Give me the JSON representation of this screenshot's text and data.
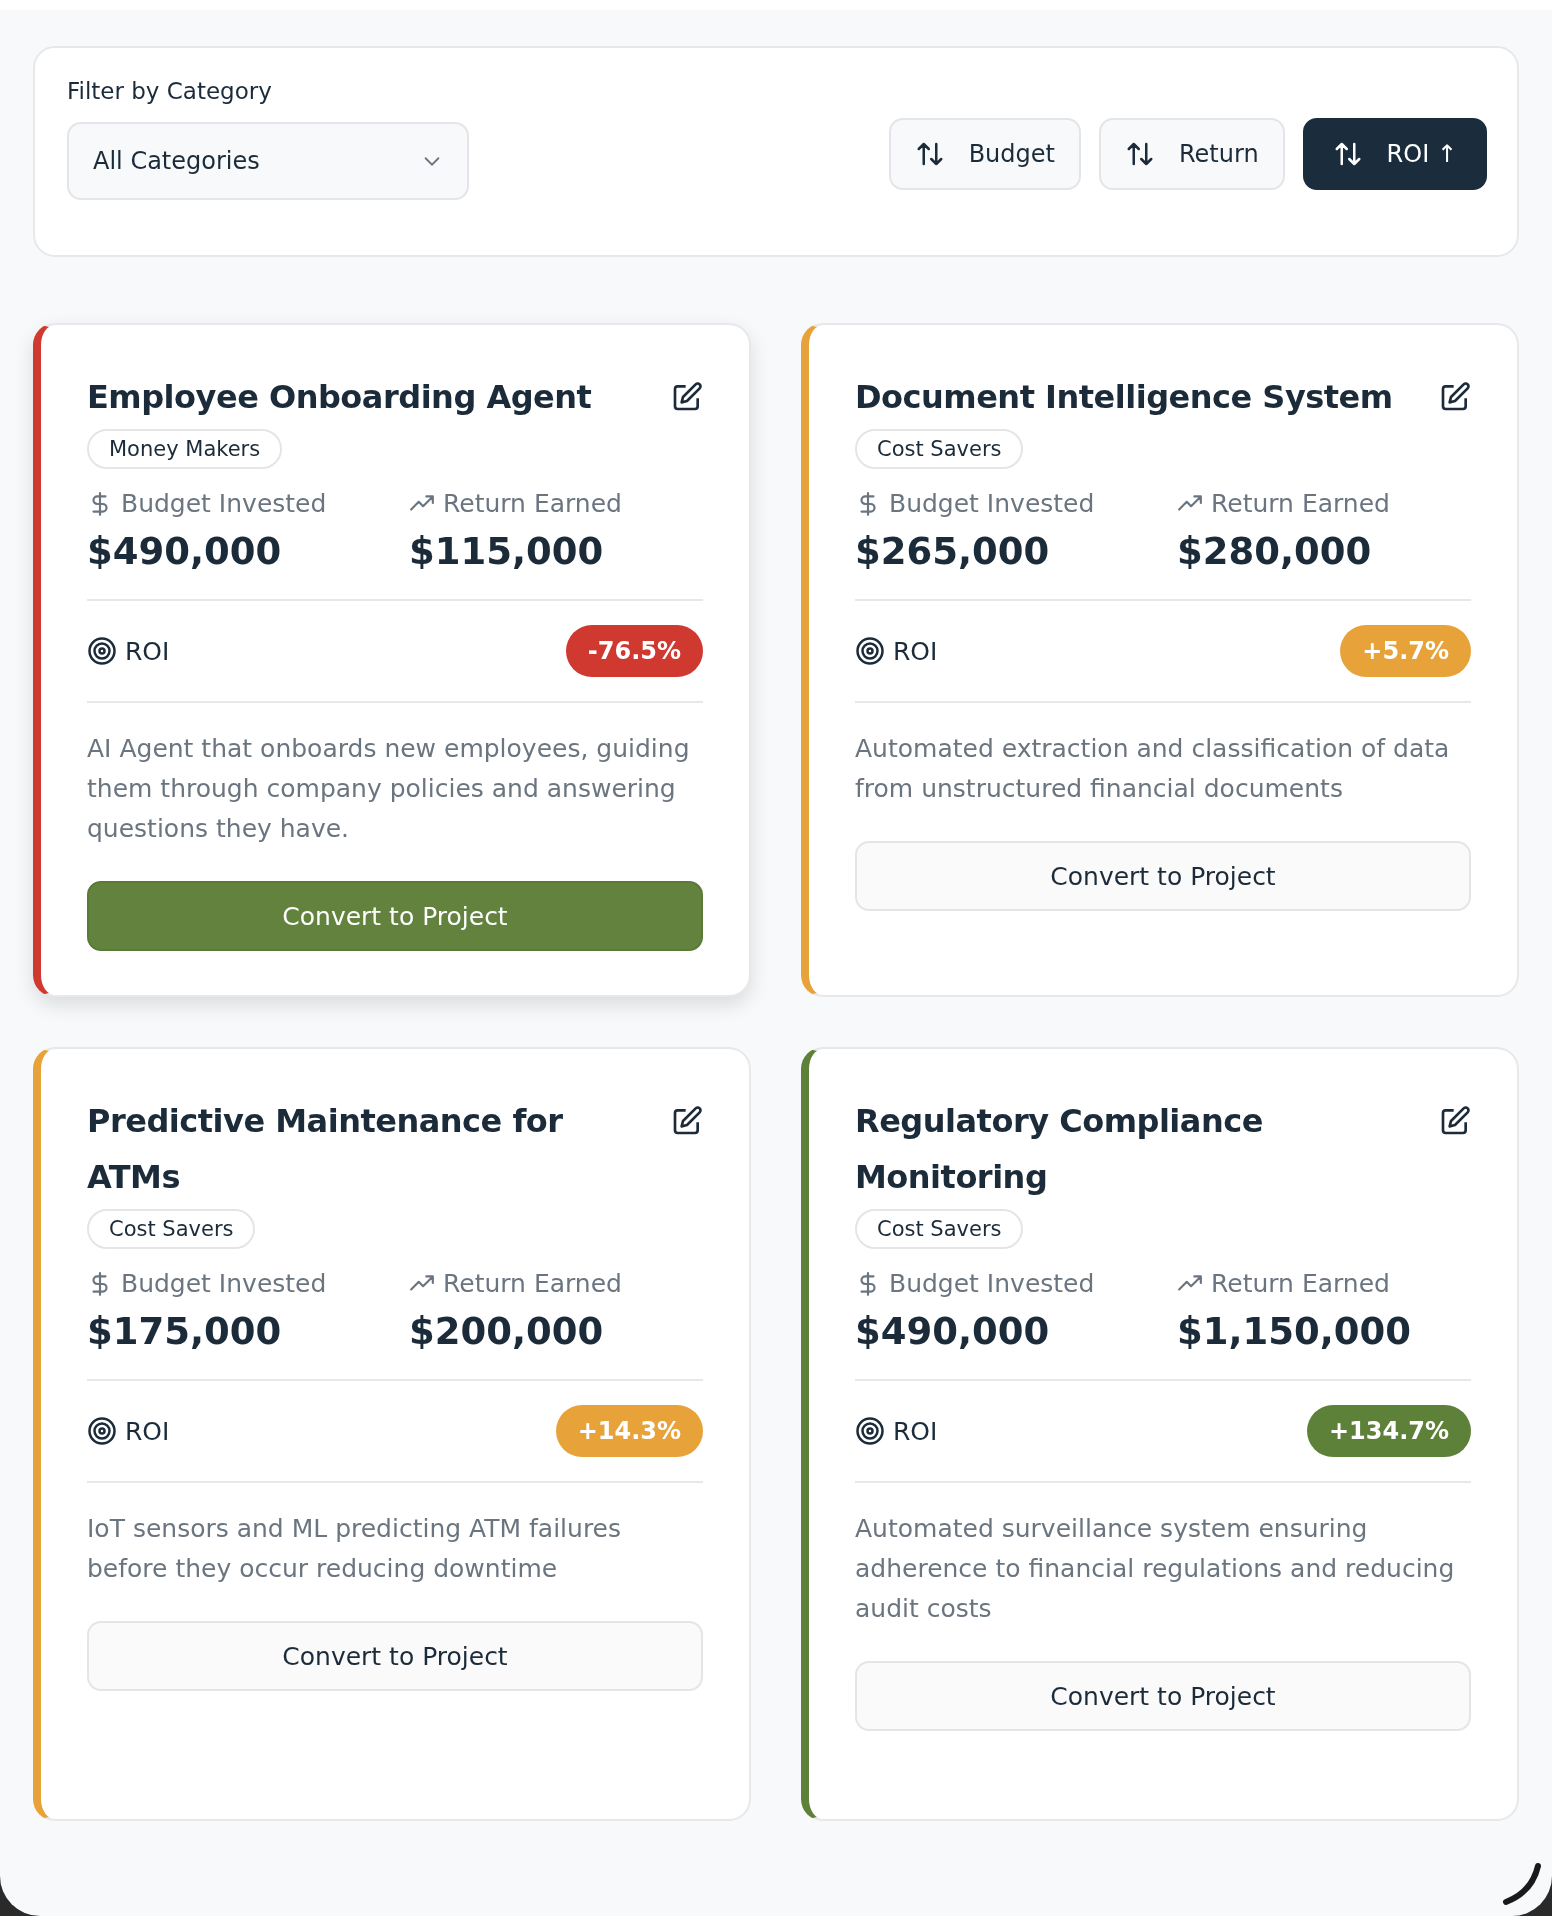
{
  "filter": {
    "label": "Filter by Category",
    "value": "All Categories"
  },
  "sort_buttons": [
    {
      "label": "Budget",
      "selected": false
    },
    {
      "label": "Return",
      "selected": false
    },
    {
      "label": "ROI",
      "selected": true,
      "direction": "↑"
    }
  ],
  "cards": [
    {
      "title": "Employee Onboarding Agent",
      "category": "Money Makers",
      "budget_label": "Budget Invested",
      "budget": "$490,000",
      "return_label": "Return Earned",
      "return": "$115,000",
      "roi_label": "ROI",
      "roi": "-76.5%",
      "color": "#d0392f",
      "description": "AI Agent that onboards new employees, guiding them through company policies and answering questions they have.",
      "button": "Convert to Project",
      "hovered": true
    },
    {
      "title": "Document Intelligence System",
      "category": "Cost Savers",
      "budget_label": "Budget Invested",
      "budget": "$265,000",
      "return_label": "Return Earned",
      "return": "$280,000",
      "roi_label": "ROI",
      "roi": "+5.7%",
      "color": "#e8a23a",
      "description": "Automated extraction and classification of data from unstructured financial documents",
      "button": "Convert to Project",
      "hovered": false
    },
    {
      "title": "Predictive Maintenance for ATMs",
      "category": "Cost Savers",
      "budget_label": "Budget Invested",
      "budget": "$175,000",
      "return_label": "Return Earned",
      "return": "$200,000",
      "roi_label": "ROI",
      "roi": "+14.3%",
      "color": "#e8a23a",
      "description": "IoT sensors and ML predicting ATM failures before they occur reducing downtime",
      "button": "Convert to Project",
      "hovered": false
    },
    {
      "title": "Regulatory Compliance Monitoring",
      "category": "Cost Savers",
      "budget_label": "Budget Invested",
      "budget": "$490,000",
      "return_label": "Return Earned",
      "return": "$1,150,000",
      "roi_label": "ROI",
      "roi": "+134.7%",
      "color": "#5e8139",
      "description": "Automated surveillance system ensuring adherence to financial regulations and reducing audit costs",
      "button": "Convert to Project",
      "hovered": false
    }
  ]
}
